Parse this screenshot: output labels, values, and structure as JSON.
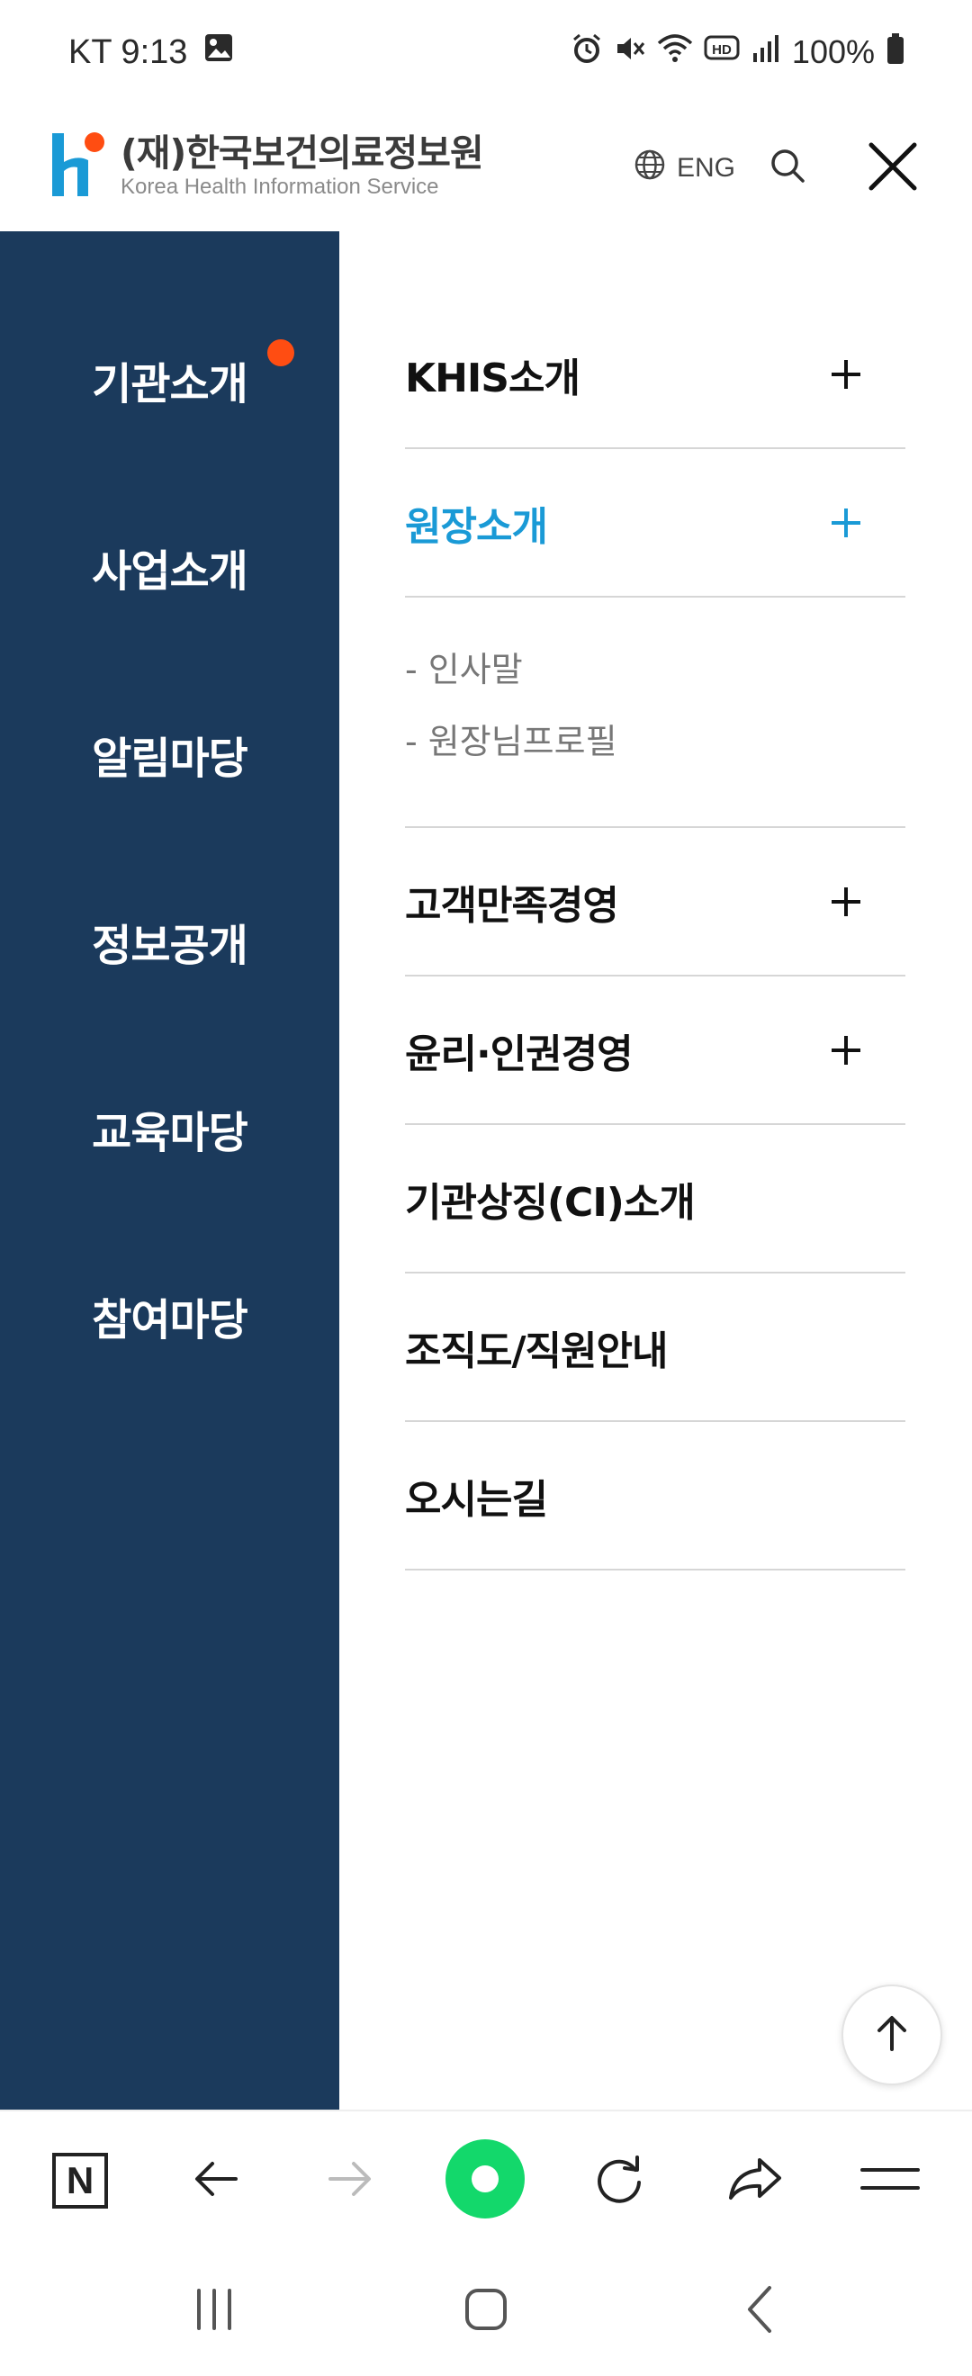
{
  "status_bar": {
    "carrier_time": "KT 9:13",
    "battery": "100%",
    "icons": [
      "gallery-icon",
      "alarm-icon",
      "mute-icon",
      "wifi-icon",
      "hd-icon",
      "signal-icon",
      "battery-icon"
    ]
  },
  "header": {
    "logo_kr": "(재)한국보건의료정보원",
    "logo_en": "Korea Health Information Service",
    "lang_label": "ENG"
  },
  "side_nav": {
    "items": [
      {
        "label": "기관소개",
        "active": true
      },
      {
        "label": "사업소개"
      },
      {
        "label": "알림마당"
      },
      {
        "label": "정보공개"
      },
      {
        "label": "교육마당"
      },
      {
        "label": "참여마당"
      }
    ]
  },
  "sub_menu": {
    "items": [
      {
        "label": "KHIS소개",
        "expandable": true
      },
      {
        "label": "원장소개",
        "expandable": true,
        "active": true
      },
      {
        "label": "고객만족경영",
        "expandable": true
      },
      {
        "label": "윤리·인권경영",
        "expandable": true
      },
      {
        "label": "기관상징(CI)소개"
      },
      {
        "label": "조직도/직원안내"
      },
      {
        "label": "오시는길"
      }
    ],
    "children": [
      {
        "label": "-  인사말"
      },
      {
        "label": "-  원장님프로필"
      }
    ]
  },
  "colors": {
    "nav_bg": "#1b3a5c",
    "accent": "#1a9ad6",
    "dot": "#ff4d12",
    "browser_green": "#13d86b"
  }
}
